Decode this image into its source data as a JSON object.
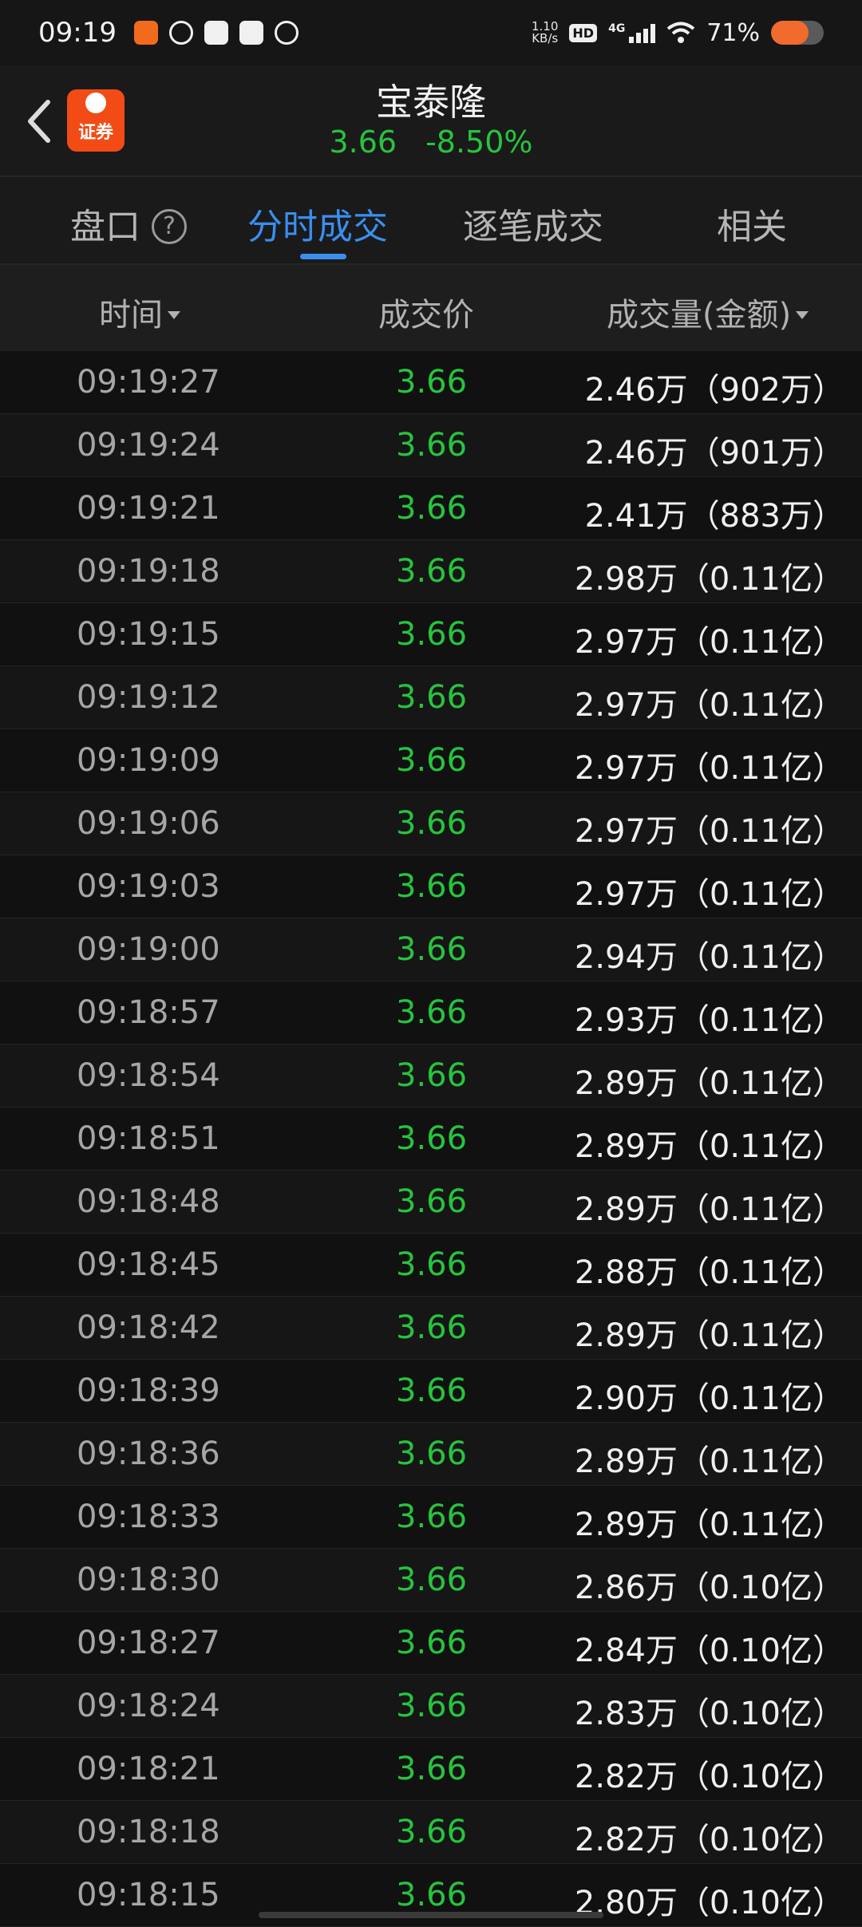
{
  "status_bar": {
    "time": "09:19",
    "net_speed_value": "1.10",
    "net_speed_unit": "KB/s",
    "hd": "HD",
    "network": "4G",
    "battery": "71%",
    "battery_level": 0.71
  },
  "header": {
    "logo_text": "证券",
    "stock_name": "宝泰隆",
    "price": "3.66",
    "change_pct": "-8.50%"
  },
  "tabs": [
    {
      "label": "盘口"
    },
    {
      "label": "分时成交"
    },
    {
      "label": "逐笔成交"
    },
    {
      "label": "相关"
    }
  ],
  "help_glyph": "?",
  "columns": {
    "time": "时间",
    "price": "成交价",
    "volume": "成交量(金额)"
  },
  "colors": {
    "down": "#27c43d",
    "accent": "#3a8ef0"
  },
  "rows": [
    {
      "time": "09:19:27",
      "price": "3.66",
      "volume": "2.46万（902万）"
    },
    {
      "time": "09:19:24",
      "price": "3.66",
      "volume": "2.46万（901万）"
    },
    {
      "time": "09:19:21",
      "price": "3.66",
      "volume": "2.41万（883万）"
    },
    {
      "time": "09:19:18",
      "price": "3.66",
      "volume": "2.98万（0.11亿）"
    },
    {
      "time": "09:19:15",
      "price": "3.66",
      "volume": "2.97万（0.11亿）"
    },
    {
      "time": "09:19:12",
      "price": "3.66",
      "volume": "2.97万（0.11亿）"
    },
    {
      "time": "09:19:09",
      "price": "3.66",
      "volume": "2.97万（0.11亿）"
    },
    {
      "time": "09:19:06",
      "price": "3.66",
      "volume": "2.97万（0.11亿）"
    },
    {
      "time": "09:19:03",
      "price": "3.66",
      "volume": "2.97万（0.11亿）"
    },
    {
      "time": "09:19:00",
      "price": "3.66",
      "volume": "2.94万（0.11亿）"
    },
    {
      "time": "09:18:57",
      "price": "3.66",
      "volume": "2.93万（0.11亿）"
    },
    {
      "time": "09:18:54",
      "price": "3.66",
      "volume": "2.89万（0.11亿）"
    },
    {
      "time": "09:18:51",
      "price": "3.66",
      "volume": "2.89万（0.11亿）"
    },
    {
      "time": "09:18:48",
      "price": "3.66",
      "volume": "2.89万（0.11亿）"
    },
    {
      "time": "09:18:45",
      "price": "3.66",
      "volume": "2.88万（0.11亿）"
    },
    {
      "time": "09:18:42",
      "price": "3.66",
      "volume": "2.89万（0.11亿）"
    },
    {
      "time": "09:18:39",
      "price": "3.66",
      "volume": "2.90万（0.11亿）"
    },
    {
      "time": "09:18:36",
      "price": "3.66",
      "volume": "2.89万（0.11亿）"
    },
    {
      "time": "09:18:33",
      "price": "3.66",
      "volume": "2.89万（0.11亿）"
    },
    {
      "time": "09:18:30",
      "price": "3.66",
      "volume": "2.86万（0.10亿）"
    },
    {
      "time": "09:18:27",
      "price": "3.66",
      "volume": "2.84万（0.10亿）"
    },
    {
      "time": "09:18:24",
      "price": "3.66",
      "volume": "2.83万（0.10亿）"
    },
    {
      "time": "09:18:21",
      "price": "3.66",
      "volume": "2.82万（0.10亿）"
    },
    {
      "time": "09:18:18",
      "price": "3.66",
      "volume": "2.82万（0.10亿）"
    },
    {
      "time": "09:18:15",
      "price": "3.66",
      "volume": "2.80万（0.10亿）"
    }
  ]
}
